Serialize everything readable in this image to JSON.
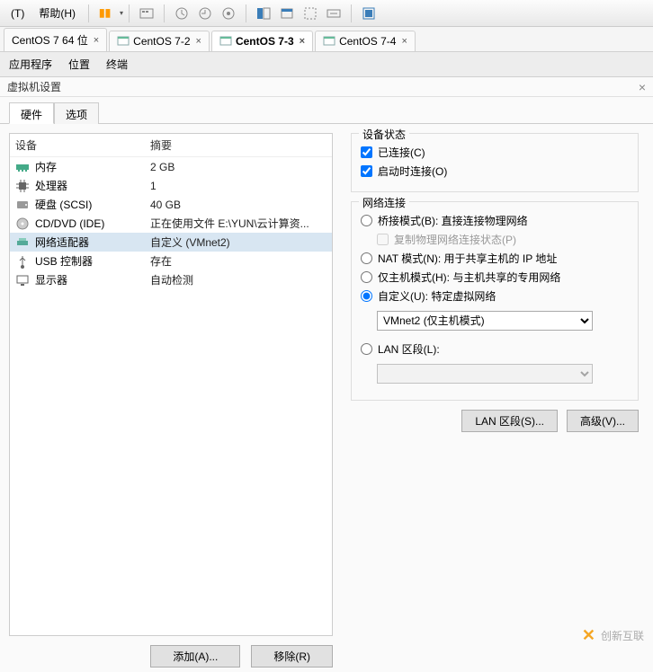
{
  "toolbar": {
    "menu_edit": "(T)",
    "menu_help": "帮助(H)"
  },
  "tabs": [
    {
      "label": "CentOS 7 64 位",
      "active": false
    },
    {
      "label": "CentOS 7-2",
      "active": false
    },
    {
      "label": "CentOS 7-3",
      "active": true
    },
    {
      "label": "CentOS 7-4",
      "active": false
    }
  ],
  "app_menu": {
    "apps": "应用程序",
    "loc": "位置",
    "term": "终端"
  },
  "dialog": {
    "title": "虚拟机设置",
    "tab_hw": "硬件",
    "tab_opt": "选项",
    "hw_header_device": "设备",
    "hw_header_summary": "摘要",
    "hw_rows": [
      {
        "name": "内存",
        "summary": "2 GB",
        "icon": "memory"
      },
      {
        "name": "处理器",
        "summary": "1",
        "icon": "cpu"
      },
      {
        "name": "硬盘 (SCSI)",
        "summary": "40 GB",
        "icon": "disk"
      },
      {
        "name": "CD/DVD (IDE)",
        "summary": "正在使用文件 E:\\YUN\\云计算资...",
        "icon": "cd"
      },
      {
        "name": "网络适配器",
        "summary": "自定义 (VMnet2)",
        "icon": "net",
        "selected": true
      },
      {
        "name": "USB 控制器",
        "summary": "存在",
        "icon": "usb"
      },
      {
        "name": "显示器",
        "summary": "自动检测",
        "icon": "display"
      }
    ],
    "btn_add": "添加(A)...",
    "btn_remove": "移除(R)",
    "state_legend": "设备状态",
    "chk_connected": "已连接(C)",
    "chk_connect_power": "启动时连接(O)",
    "net_legend": "网络连接",
    "rad_bridge": "桥接模式(B): 直接连接物理网络",
    "chk_replicate": "复制物理网络连接状态(P)",
    "rad_nat": "NAT 模式(N): 用于共享主机的 IP 地址",
    "rad_hostonly": "仅主机模式(H): 与主机共享的专用网络",
    "rad_custom": "自定义(U): 特定虚拟网络",
    "sel_custom": "VMnet2 (仅主机模式)",
    "rad_lan": "LAN 区段(L):",
    "btn_lan": "LAN 区段(S)...",
    "btn_adv": "高级(V)..."
  },
  "watermark": "创新互联"
}
